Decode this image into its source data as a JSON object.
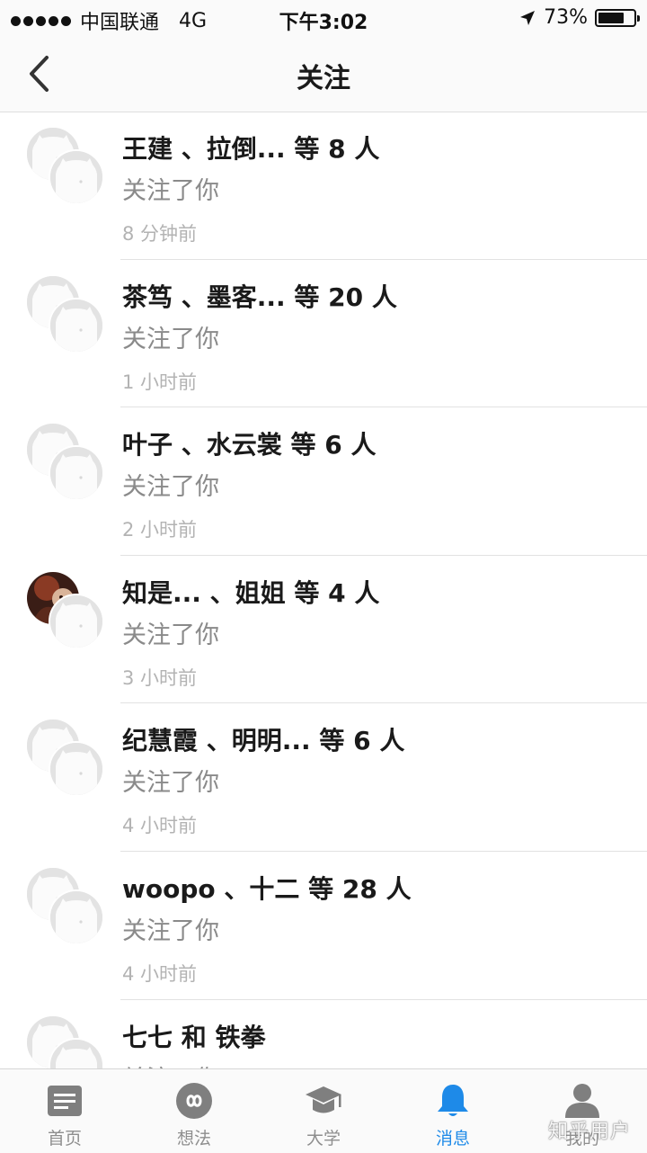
{
  "status_bar": {
    "carrier": "中国联通",
    "network": "4G",
    "time": "下午3:02",
    "battery": "73%",
    "battery_level": 0.73
  },
  "nav": {
    "title": "关注",
    "back_icon": "chevron-left-icon"
  },
  "notifications": [
    {
      "title": "王建 、拉倒... 等 8 人",
      "subtitle": "关注了你",
      "time": "8 分钟前",
      "photo_avatar": false
    },
    {
      "title": "茶笃 、墨客... 等 20 人",
      "subtitle": "关注了你",
      "time": "1 小时前",
      "photo_avatar": false
    },
    {
      "title": "叶子 、水云裳 等 6 人",
      "subtitle": "关注了你",
      "time": "2 小时前",
      "photo_avatar": false
    },
    {
      "title": "知是... 、姐姐 等 4 人",
      "subtitle": "关注了你",
      "time": "3 小时前",
      "photo_avatar": true
    },
    {
      "title": "纪慧霞 、明明... 等 6 人",
      "subtitle": "关注了你",
      "time": "4 小时前",
      "photo_avatar": false
    },
    {
      "title": "woopo 、十二 等 28 人",
      "subtitle": "关注了你",
      "time": "4 小时前",
      "photo_avatar": false
    },
    {
      "title": "七七 和 铁拳",
      "subtitle": "关注了你",
      "time": "",
      "photo_avatar": false
    }
  ],
  "tab_bar": {
    "tabs": [
      {
        "label": "首页",
        "icon": "home-feed-icon"
      },
      {
        "label": "想法",
        "icon": "ideas-icon"
      },
      {
        "label": "大学",
        "icon": "graduation-cap-icon"
      },
      {
        "label": "消息",
        "icon": "bell-icon"
      },
      {
        "label": "我的",
        "icon": "user-icon"
      }
    ],
    "active_index": 3
  },
  "watermark": "知乎用户",
  "colors": {
    "accent": "#1e8ae8",
    "inactive_icon": "#7f7f7f",
    "text_primary": "#1a1a1a",
    "text_secondary": "#8a8a8a",
    "text_time": "#b3b3b3"
  }
}
